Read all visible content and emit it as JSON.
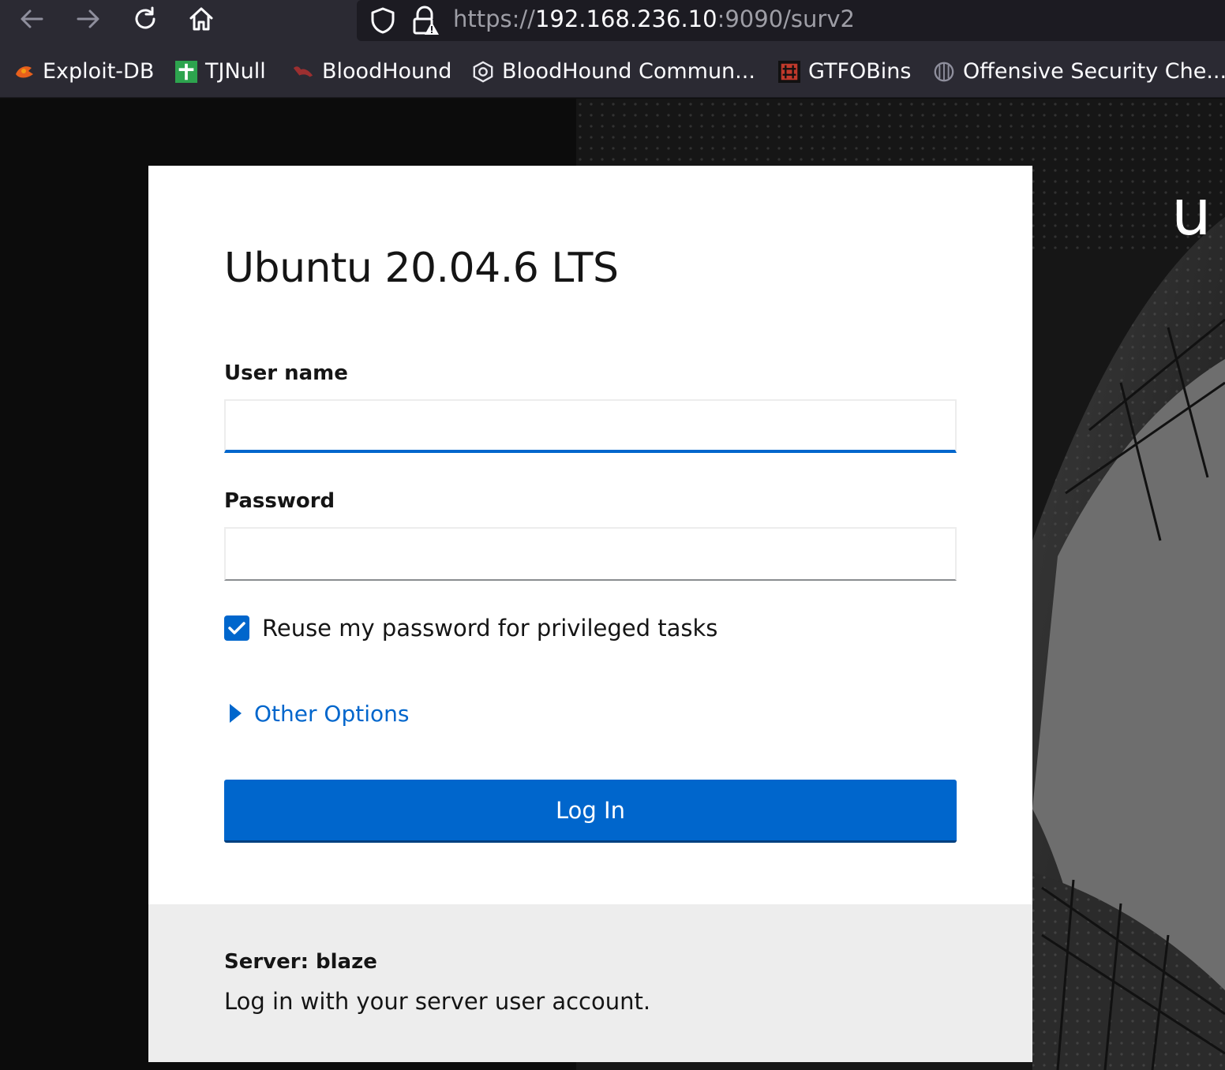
{
  "browser": {
    "url": {
      "scheme": "https://",
      "host": "192.168.236.10",
      "rest": ":9090/surv2"
    },
    "nav_icons": [
      "back-icon",
      "forward-icon",
      "reload-icon",
      "home-icon"
    ],
    "bookmarks": [
      {
        "label": "Exploit-DB",
        "icon": "exploit-db-icon"
      },
      {
        "label": "TJNull",
        "icon": "tjnull-icon"
      },
      {
        "label": "BloodHound",
        "icon": "bloodhound-icon"
      },
      {
        "label": "BloodHound Commun...",
        "icon": "bloodhound-community-icon"
      },
      {
        "label": "GTFOBins",
        "icon": "gtfobins-icon"
      },
      {
        "label": "Offensive Security Che...",
        "icon": "offsec-icon"
      }
    ]
  },
  "background": {
    "brand_partial": "u"
  },
  "login": {
    "title": "Ubuntu 20.04.6 LTS",
    "username_label": "User name",
    "username_value": "",
    "password_label": "Password",
    "password_value": "",
    "reuse_password_label": "Reuse my password for privileged tasks",
    "reuse_password_checked": true,
    "other_options_label": "Other Options",
    "login_button_label": "Log In",
    "server_label": "Server: blaze",
    "server_help": "Log in with your server user account."
  },
  "colors": {
    "accent": "#0066cc",
    "browser_chrome": "#2b2a33",
    "footer_bg": "#ededed"
  }
}
